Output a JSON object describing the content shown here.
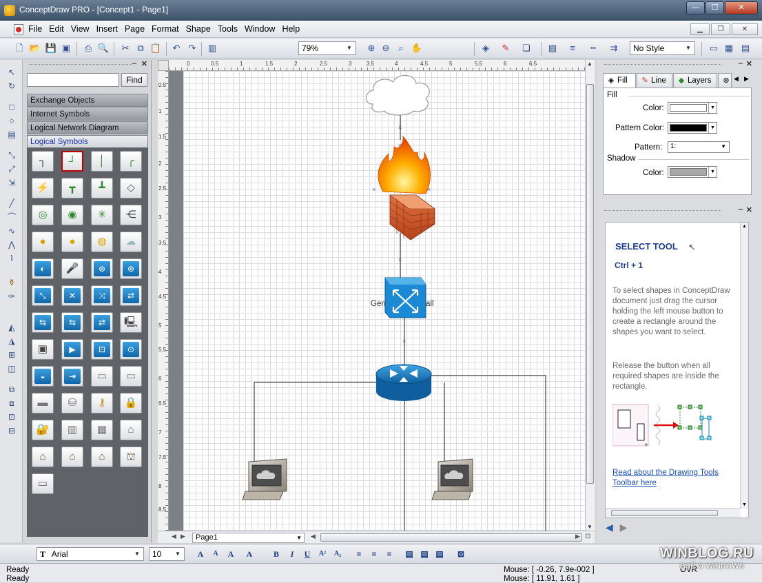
{
  "window": {
    "title": "ConceptDraw PRO - [Concept1 - Page1]",
    "minimize": "—",
    "maximize": "☐",
    "close": "✕"
  },
  "menu": [
    "File",
    "Edit",
    "View",
    "Insert",
    "Page",
    "Format",
    "Shape",
    "Tools",
    "Window",
    "Help"
  ],
  "toolbar": {
    "zoom": "79%",
    "style": "No Style"
  },
  "library": {
    "search_value": "",
    "find_label": "Find",
    "categories": [
      "Exchange Objects",
      "Internet Symbols",
      "Logical Network Diagram",
      "Logical Symbols"
    ],
    "active_category": "Logical Symbols"
  },
  "rulers": {
    "h_ticks": [
      "0",
      "0.5",
      "1",
      "1.5",
      "2",
      "2.5",
      "3",
      "3.5",
      "4",
      "4.5",
      "5",
      "5.5",
      "6",
      "6.5"
    ],
    "v_ticks": [
      "0.5",
      "1",
      "1.5",
      "2",
      "2.5",
      "3",
      "3.5",
      "4",
      "4.5",
      "5",
      "5.5",
      "6",
      "6.5",
      "7",
      "7.5",
      "8",
      "8.5"
    ]
  },
  "diagram": {
    "switch_label": "Gen",
    "switch_label_tail": "all"
  },
  "page_tab": "Page1",
  "fill_panel": {
    "tabs": [
      "Fill",
      "Line",
      "Layers"
    ],
    "section_fill": "Fill",
    "color_label": "Color:",
    "color_value": "#ffffff",
    "pattern_color_label": "Pattern Color:",
    "pattern_color_value": "#000000",
    "pattern_label": "Pattern:",
    "pattern_value": "1:",
    "section_shadow": "Shadow",
    "shadow_color_label": "Color:",
    "shadow_color_value": "#a8a8a8"
  },
  "help": {
    "title": "SELECT TOOL",
    "shortcut": "Ctrl + 1",
    "para1": "To select shapes in ConceptDraw document just drag the cursor holding the left mouse button to create a rectangle around the shapes you want to select.",
    "para2": "Release the button when all required shapes are inside the rectangle.",
    "link": "Read about the Drawing Tools Toolbar here"
  },
  "format_bar": {
    "font": "Arial",
    "size": "10"
  },
  "status": {
    "line1_left": "Ready",
    "line1_mouse": "Mouse: [ -0.26, 7.9e-002 ]",
    "line1_right": "OVR",
    "line2_left": "Ready",
    "line2_mouse": "Mouse: [ 11.91, 1.61 ]"
  },
  "watermark": {
    "site": "WINBLOG.RU",
    "tagline": "ВСЁ О WINDOWS"
  },
  "colors": {
    "accent_link": "#1a4fb8",
    "help_title": "#1c3d8f",
    "switch_blue": "#1a8ad4",
    "selection_red": "#c00000"
  }
}
